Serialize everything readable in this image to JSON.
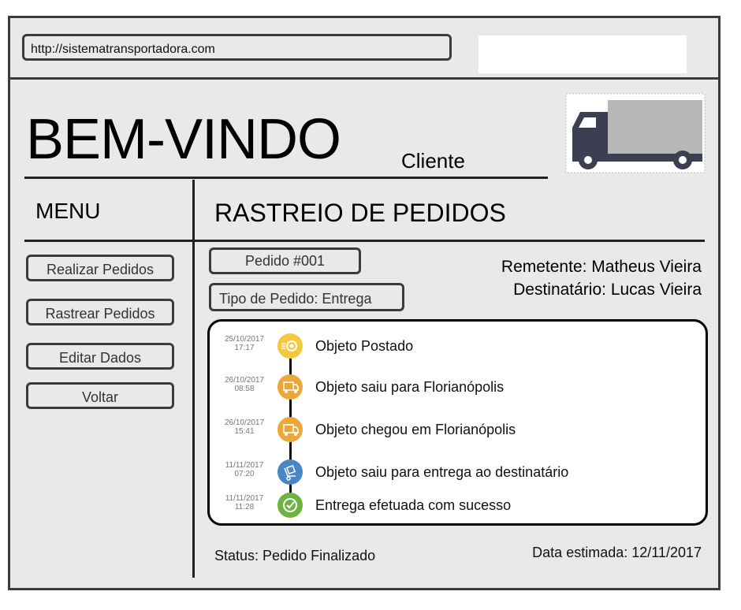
{
  "browser": {
    "url": "http://sistematransportadora.com"
  },
  "header": {
    "title": "BEM-VINDO",
    "subtitle": "Cliente"
  },
  "menu": {
    "title": "MENU",
    "items": [
      {
        "label": "Realizar Pedidos"
      },
      {
        "label": "Rastrear Pedidos"
      },
      {
        "label": "Editar Dados"
      },
      {
        "label": "Voltar"
      }
    ]
  },
  "tracking": {
    "title": "RASTREIO DE PEDIDOS",
    "order_label": "Pedido #001",
    "type_label": "Tipo de Pedido: Entrega",
    "sender": "Remetente: Matheus Vieira",
    "receiver": "Destinatário: Lucas Vieira",
    "events": [
      {
        "date": "25/10/2017",
        "time": "17:17",
        "text": "Objeto Postado",
        "icon": "posted-icon",
        "color": "#f5c842"
      },
      {
        "date": "26/10/2017",
        "time": "08:58",
        "text": "Objeto saiu para Florianópolis",
        "icon": "truck-icon",
        "color": "#eba83a"
      },
      {
        "date": "26/10/2017",
        "time": "15:41",
        "text": "Objeto chegou em Florianópolis",
        "icon": "truck-icon",
        "color": "#eba83a"
      },
      {
        "date": "11/11/2017",
        "time": "07:20",
        "text": "Objeto saiu para entrega ao destinatário",
        "icon": "delivery-icon",
        "color": "#4a86c5"
      },
      {
        "date": "11/11/2017",
        "time": "11:28",
        "text": "Entrega efetuada com sucesso",
        "icon": "check-icon",
        "color": "#6cb33f"
      }
    ],
    "status": "Status: Pedido Finalizado",
    "estimate": "Data estimada: 12/11/2017"
  }
}
